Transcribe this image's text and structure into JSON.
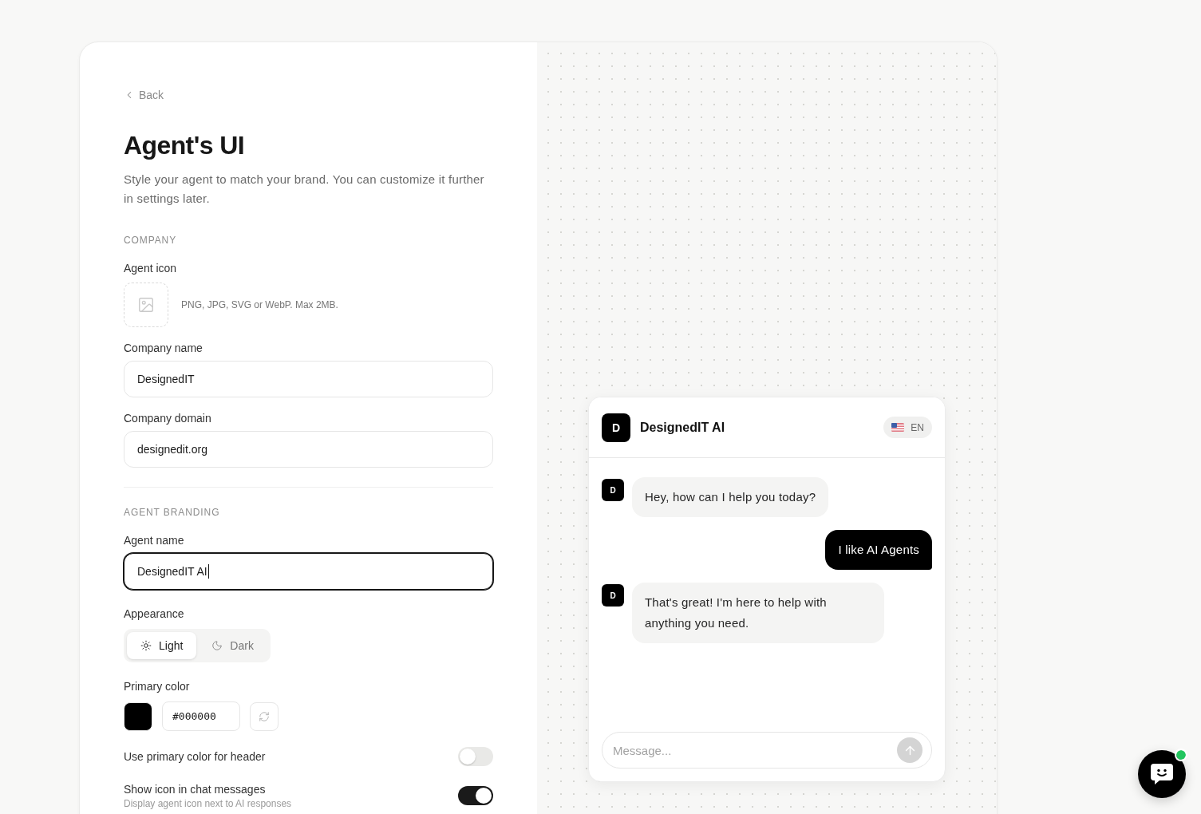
{
  "back_link": {
    "label": "Back"
  },
  "title": "Agent's UI",
  "description": "Style your agent to match your brand. You can customize it further in settings later.",
  "sections": [
    {
      "heading": "COMPANY",
      "fields": [
        {
          "kind": "upload",
          "label": "Agent icon",
          "hint": "PNG, JPG, SVG or WebP. Max 2MB."
        },
        {
          "kind": "text",
          "label": "Company name",
          "value": "DesignedIT",
          "focused": false
        },
        {
          "kind": "text",
          "label": "Company domain",
          "value": "designedit.org",
          "focused": false
        }
      ]
    },
    {
      "heading": "AGENT BRANDING",
      "fields": [
        {
          "kind": "text",
          "label": "Agent name",
          "value": "DesignedIT AI",
          "focused": true
        },
        {
          "kind": "segmented",
          "label": "Appearance",
          "options": [
            {
              "label": "Light",
              "selected": true
            },
            {
              "label": "Dark",
              "selected": false
            }
          ]
        },
        {
          "kind": "color",
          "label": "Primary color",
          "value": "#000000",
          "color": "#000000"
        },
        {
          "kind": "toggle",
          "label": "Use primary color for header",
          "on": false
        },
        {
          "kind": "toggle",
          "label": "Show icon in chat messages",
          "description": "Display agent icon next to AI responses",
          "on": true
        }
      ]
    }
  ],
  "preview": {
    "header": {
      "avatar_letter": "D",
      "title": "DesignedIT AI",
      "language": "EN"
    },
    "messages": [
      {
        "kind": "agent",
        "avatar_letter": "D",
        "text": "Hey, how can I help you today?"
      },
      {
        "kind": "user",
        "text": "I like AI Agents"
      },
      {
        "kind": "agent",
        "avatar_letter": "D",
        "text": "That's great! I'm here to help with anything you need."
      }
    ],
    "composer": {
      "placeholder": "Message..."
    }
  },
  "launcher": {
    "online": true
  }
}
